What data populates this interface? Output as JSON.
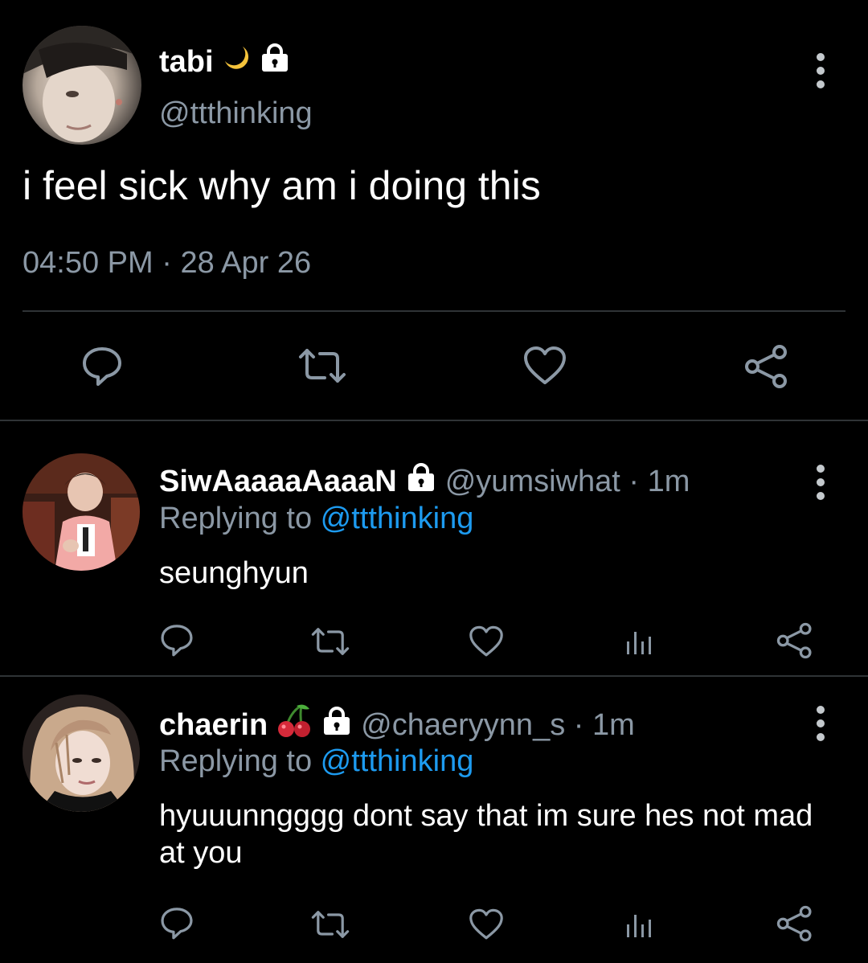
{
  "main_tweet": {
    "display_name": "tabi",
    "name_emoji": "moon-icon",
    "protected_icon": "lock-icon",
    "handle": "@ttthinking",
    "text": "i feel sick why am i doing this",
    "time": "04:50 PM",
    "separator": "·",
    "date": "28 Apr 26",
    "actions": [
      "reply-icon",
      "retweet-icon",
      "like-icon",
      "share-icon"
    ]
  },
  "replies": [
    {
      "display_name": "SiwAaaaaAaaaN",
      "protected_icon": "lock-icon",
      "handle_time": "@yumsiwhat · 1m",
      "replying_prefix": "Replying to ",
      "replying_mention": "@ttthinking",
      "text": "seunghyun",
      "actions": [
        "reply-icon",
        "retweet-icon",
        "like-icon",
        "analytics-icon",
        "share-icon"
      ]
    },
    {
      "display_name": "chaerin",
      "name_emoji": "cherries-icon",
      "protected_icon": "lock-icon",
      "handle_time": "@chaeryynn_s · 1m",
      "replying_prefix": "Replying to ",
      "replying_mention": "@ttthinking",
      "text": "hyuuunngggg dont say that im sure hes not mad at you",
      "actions": [
        "reply-icon",
        "retweet-icon",
        "like-icon",
        "analytics-icon",
        "share-icon"
      ]
    }
  ],
  "colors": {
    "background": "#000000",
    "text": "#ffffff",
    "secondary": "#8b98a5",
    "link": "#1d9bf0",
    "divider": "#2f3336"
  }
}
